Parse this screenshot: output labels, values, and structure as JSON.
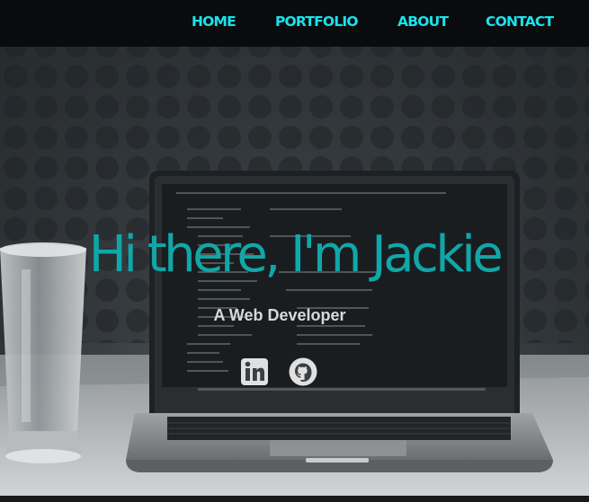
{
  "nav": {
    "items": [
      {
        "label": "HOME"
      },
      {
        "label": "PORTFOLIO"
      },
      {
        "label": "ABOUT"
      },
      {
        "label": "CONTACT"
      }
    ],
    "link_color": "#19e3ec",
    "background": "#0a0b0d"
  },
  "hero": {
    "title": "Hi there, I'm Jackie",
    "subtitle": "A Web Developer",
    "title_color": "#11a7a8",
    "subtitle_color": "#d9d9d9",
    "background_image": "laptop-and-glass-photo",
    "social_links": [
      {
        "icon": "linkedin-icon"
      },
      {
        "icon": "github-icon"
      }
    ]
  }
}
